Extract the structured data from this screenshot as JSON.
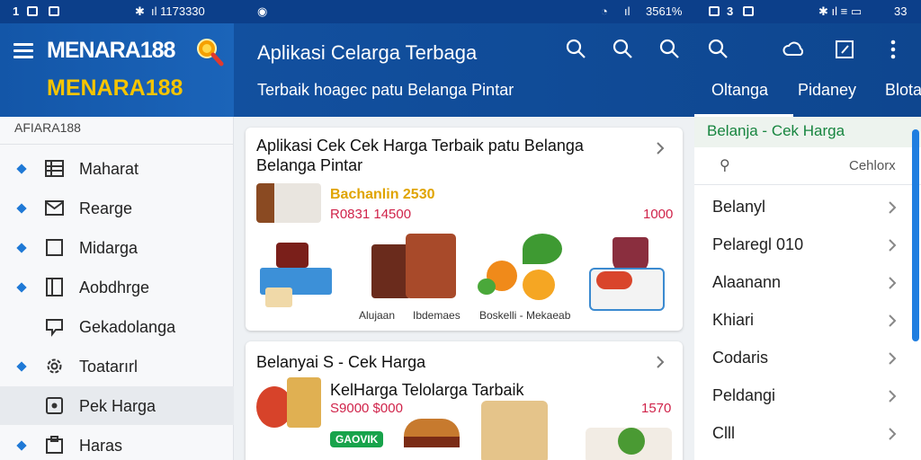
{
  "status": {
    "left_num": "1",
    "signal_text": "ıl 1173330",
    "center_battery": "3561%",
    "right_num": "3",
    "right_end": "33"
  },
  "drawer": {
    "brand_line1": "MENARA188",
    "brand_line2": "MENARA188",
    "subtitle": "AFIARA188",
    "items": [
      {
        "label": "Maharat",
        "icon": "list-icon",
        "dot": true,
        "active": false
      },
      {
        "label": "Rearge",
        "icon": "mail-icon",
        "dot": true,
        "active": false
      },
      {
        "label": "Midarga",
        "icon": "square-icon",
        "dot": true,
        "active": false
      },
      {
        "label": "Aobdhrge",
        "icon": "panel-icon",
        "dot": true,
        "active": false
      },
      {
        "label": "Gekadolanga",
        "icon": "chat-icon",
        "dot": false,
        "active": false
      },
      {
        "label": "Toatarırl",
        "icon": "gear-icon",
        "dot": true,
        "active": false
      },
      {
        "label": "Pek Harga",
        "icon": "tag-icon",
        "dot": false,
        "active": true
      },
      {
        "label": "Haras",
        "icon": "folder-icon",
        "dot": true,
        "active": false
      }
    ]
  },
  "appbar": {
    "title": "Aplikasi Celarga Terbaga",
    "subtitle": "Terbaik hoagec patu Belanga Pintar",
    "tabs": [
      "Oltanga",
      "Pidaney",
      "Blota"
    ],
    "active_tab": 0
  },
  "cards": [
    {
      "title": "Aplikasi Cek Cek Harga Terbaik patu Belanga\nBelanga Pintar",
      "deal_title": "Bachanlin 2530",
      "deal_price": "R0831 14500",
      "deal_price_right": "1000",
      "captions": [
        "Alujaan",
        "Ibdemaes",
        "Boskelli - Mekaeab",
        ""
      ]
    },
    {
      "title": "Belanyai S - Cek Harga",
      "deal_title": "KelHarga Telolarga Tarbaik",
      "deal_price": "S9000 $000",
      "deal_price_right": "1570",
      "badge": "GAOVIK"
    }
  ],
  "rpanel": {
    "title": "Belanja - Cek Harga",
    "search_icon": "search-icon",
    "search_text": "Cehlorx",
    "items": [
      "Belanyl",
      "Pelaregl 010",
      "Alaanann",
      "Khiari",
      "Codaris",
      "Peldangi",
      "Clll"
    ]
  },
  "colors": {
    "appbar": "#0e468f",
    "accent_yellow": "#f5c400",
    "accent_green": "#17853f",
    "price_red": "#d0234a",
    "scroll_blue": "#1f7ee0"
  }
}
